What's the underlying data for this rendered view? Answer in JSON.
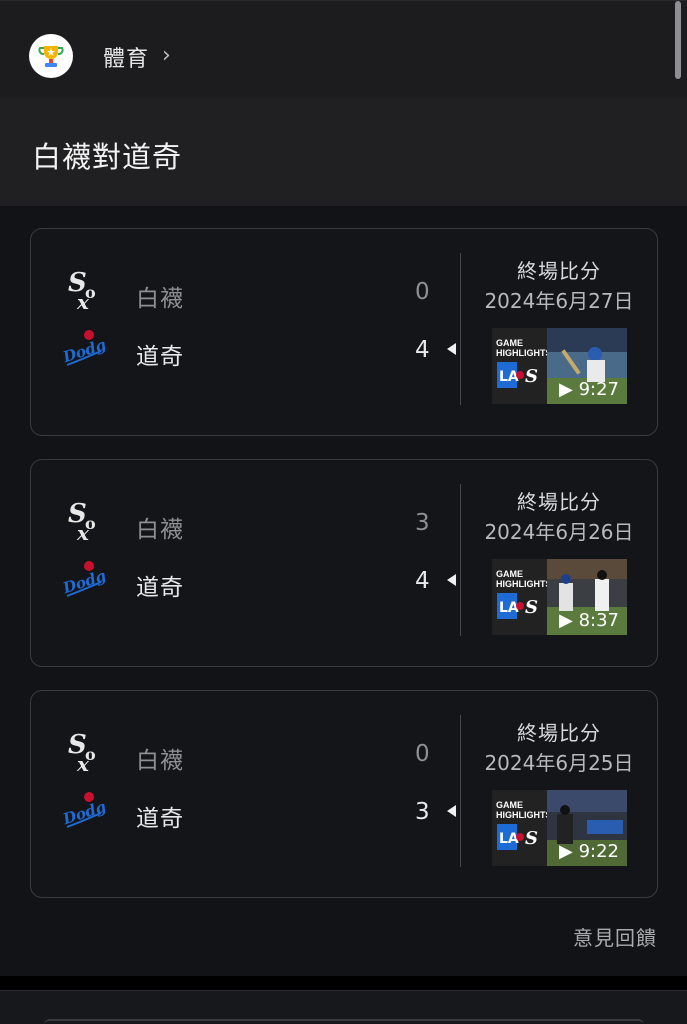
{
  "header": {
    "category_label": "體育",
    "chevron": "›",
    "icon": "trophy-icon"
  },
  "title": "白襪對道奇",
  "teams": {
    "away": "白襪",
    "home": "道奇"
  },
  "games": [
    {
      "status": "終場比分",
      "date": "2024年6月27日",
      "away_score": "0",
      "home_score": "4",
      "winner": "home",
      "highlight_label": "GAME HIGHLIGHTS",
      "duration": "▶ 9:27"
    },
    {
      "status": "終場比分",
      "date": "2024年6月26日",
      "away_score": "3",
      "home_score": "4",
      "winner": "home",
      "highlight_label": "GAME HIGHLIGHTS",
      "duration": "▶ 8:37"
    },
    {
      "status": "終場比分",
      "date": "2024年6月25日",
      "away_score": "0",
      "home_score": "3",
      "winner": "home",
      "highlight_label": "GAME HIGHLIGHTS",
      "duration": "▶ 9:22"
    }
  ],
  "feedback_label": "意見回饋",
  "colors": {
    "background": "#121316",
    "card_border": "#3a3b40",
    "dodgers_blue": "#1e6bd6"
  }
}
